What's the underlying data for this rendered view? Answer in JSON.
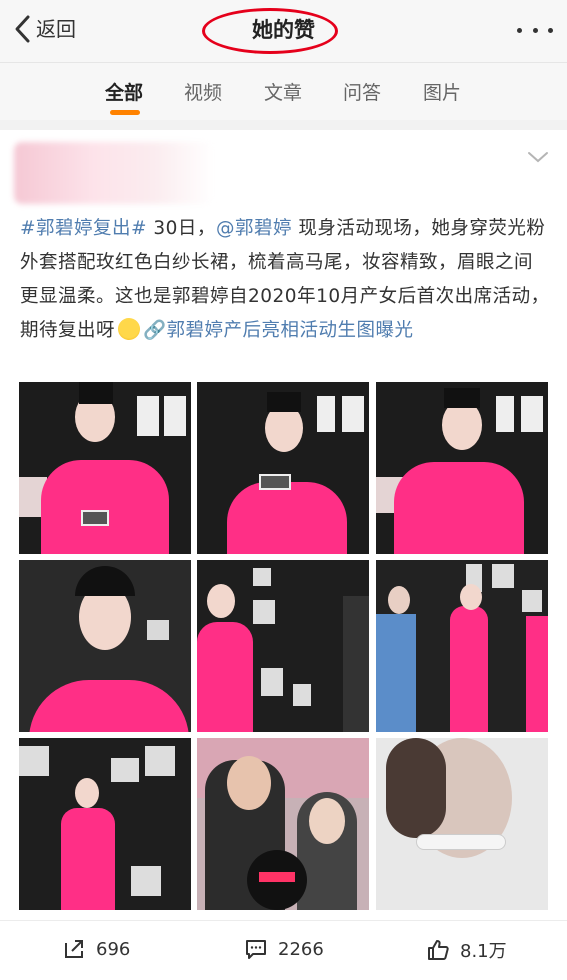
{
  "nav": {
    "back_label": "返回",
    "title": "她的赞"
  },
  "tabs": [
    {
      "label": "全部",
      "active": true
    },
    {
      "label": "视频",
      "active": false
    },
    {
      "label": "文章",
      "active": false
    },
    {
      "label": "问答",
      "active": false
    },
    {
      "label": "图片",
      "active": false
    }
  ],
  "post": {
    "text_parts": [
      {
        "text": "#郭碧婷复出#",
        "link": true
      },
      {
        "text": " 30日，",
        "link": false
      },
      {
        "text": "@郭碧婷",
        "link": true
      },
      {
        "text": " 现身活动现场，她身穿荧光粉外套搭配玫红色白纱长裙，梳着高马尾，妆容精致，眉眼之间更显温柔。这也是郭碧婷自2020年10月产女后首次出席活动，期待复出呀",
        "link": false
      },
      {
        "text": "[emoji]",
        "emoji": true
      },
      {
        "text": "🔗郭碧婷产后亮相活动生图曝光",
        "link": true
      }
    ],
    "photos": [
      {
        "name": "photo-1",
        "bg": "#1c1c1c",
        "figure": "#ff2f86"
      },
      {
        "name": "photo-2",
        "bg": "#1c1c1c",
        "figure": "#ff2f86"
      },
      {
        "name": "photo-3",
        "bg": "#1c1c1c",
        "figure": "#ff2f86"
      },
      {
        "name": "photo-4",
        "bg": "#2a2a2a",
        "figure": "#ff2f86"
      },
      {
        "name": "photo-5",
        "bg": "#1e1e1e",
        "figure": "#ff2f86"
      },
      {
        "name": "photo-6",
        "bg": "#222222",
        "figure": "#ff2f86"
      },
      {
        "name": "photo-7",
        "bg": "#1e1e1e",
        "figure": "#ff2f86"
      },
      {
        "name": "photo-8",
        "bg": "#c7b1b6",
        "figure": "#2c2c2c"
      },
      {
        "name": "photo-9",
        "bg": "#e8e8e8",
        "figure": "#d9c6bd"
      }
    ]
  },
  "actions": {
    "repost_count": "696",
    "comment_count": "2266",
    "like_count": "8.1万"
  },
  "colors": {
    "accent": "#ff8200",
    "link": "#507daf",
    "highlight_ring": "#e5001b"
  }
}
